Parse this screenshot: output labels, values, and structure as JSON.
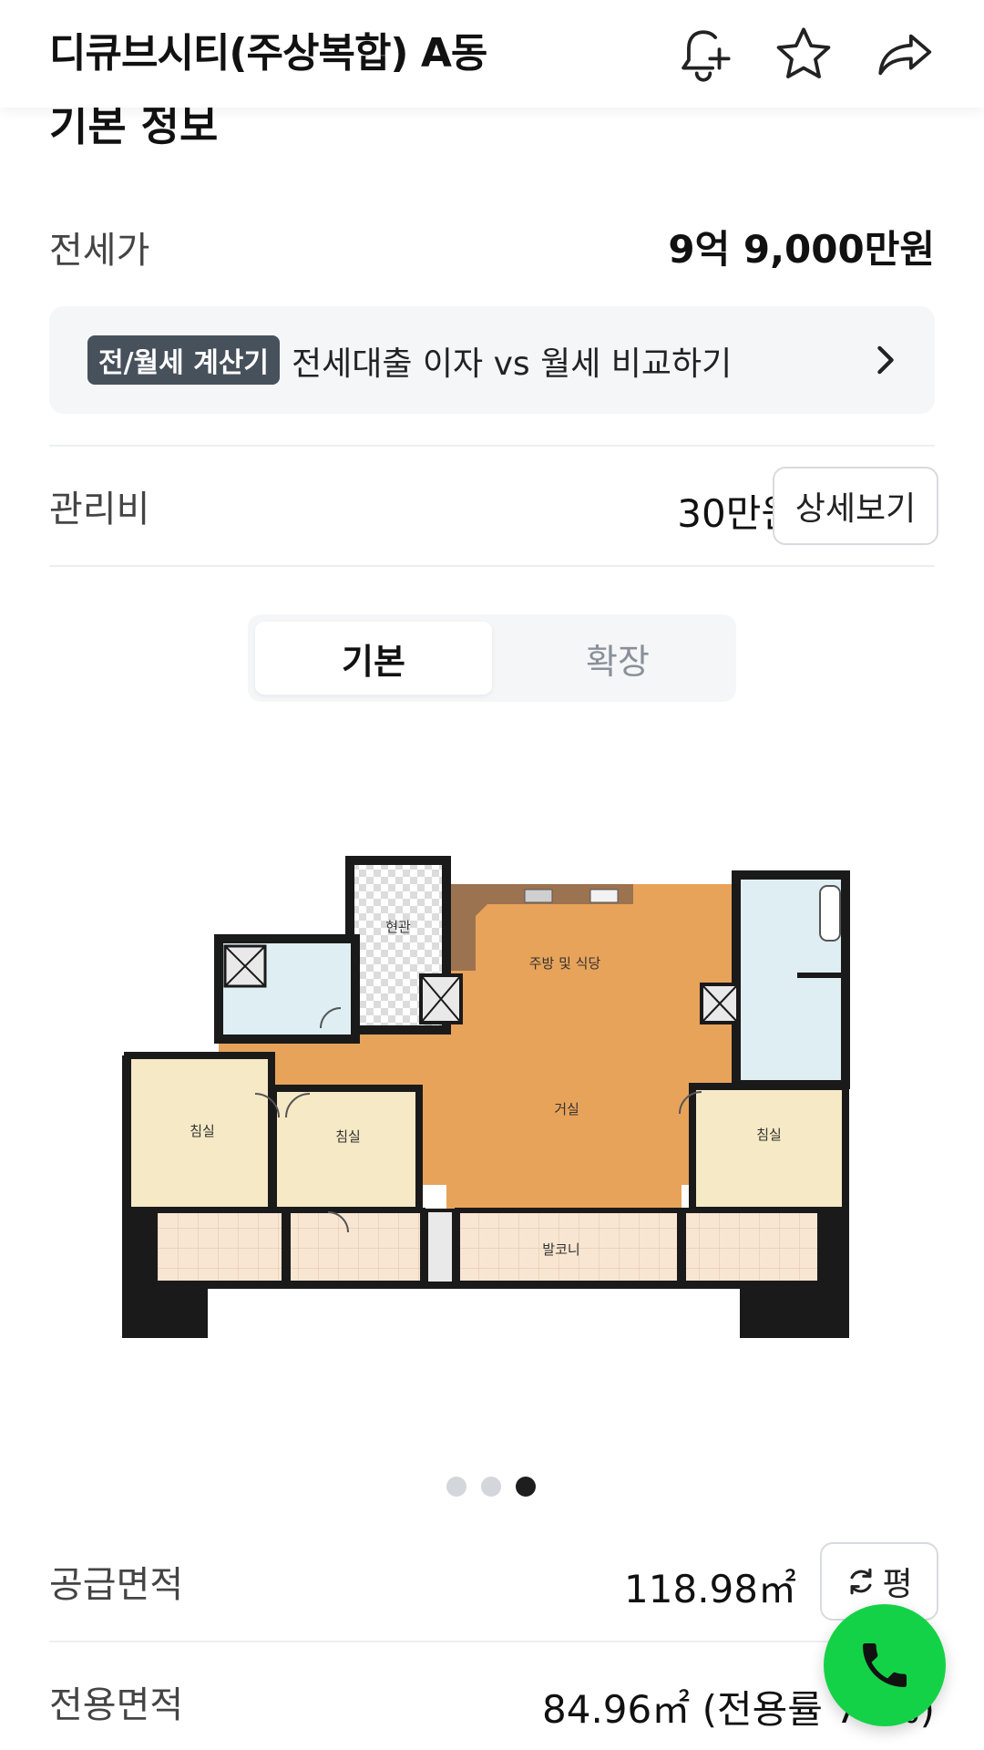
{
  "header": {
    "title": "디큐브시티(주상복합) A동",
    "icons": [
      "bell-plus-icon",
      "star-icon",
      "share-icon"
    ]
  },
  "section": {
    "heading": "기본 정보"
  },
  "jeonse": {
    "label": "전세가",
    "value": "9억 9,000만원"
  },
  "calculator": {
    "badge": "전/월세 계산기",
    "text": "전세대출 이자 vs 월세 비교하기"
  },
  "maintenance": {
    "label": "관리비",
    "value": "30만원",
    "button": "상세보기"
  },
  "plan_toggle": {
    "options": [
      "기본",
      "확장"
    ],
    "selected": "기본"
  },
  "floorplan": {
    "rooms": [
      "현관",
      "주방 및 식당",
      "침실",
      "침실",
      "거실",
      "침실",
      "발코니"
    ]
  },
  "carousel": {
    "count": 3,
    "active": 3
  },
  "supply_area": {
    "label": "공급면적",
    "value": "118.98㎡",
    "unit_button": "평"
  },
  "exclusive_area": {
    "label": "전용면적",
    "value": "84.96㎡ (전용률 71%)"
  },
  "colors": {
    "accent_green": "#14d247",
    "badge_bg": "#47515c",
    "floor_wood": "#e8a35a"
  }
}
